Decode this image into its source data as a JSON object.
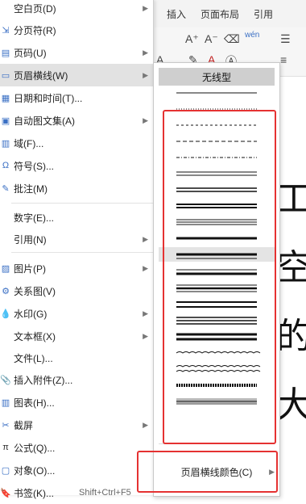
{
  "ribbon": {
    "tabs": [
      {
        "label": "插入"
      },
      {
        "label": "页面布局"
      },
      {
        "label": "引用"
      }
    ]
  },
  "document": {
    "chars": [
      "工",
      "空",
      "的",
      "大"
    ]
  },
  "menu": {
    "items": [
      {
        "label": "空白页(D)",
        "has_submenu": true,
        "icon": "none"
      },
      {
        "label": "分页符(R)",
        "has_submenu": false,
        "icon": "page-break-icon"
      },
      {
        "label": "页码(U)",
        "has_submenu": true,
        "icon": "page-number-icon"
      },
      {
        "label": "页眉横线(W)",
        "has_submenu": true,
        "icon": "header-line-icon",
        "active": true
      },
      {
        "label": "日期和时间(T)...",
        "has_submenu": false,
        "icon": "calendar-icon"
      },
      {
        "label": "自动图文集(A)",
        "has_submenu": true,
        "icon": "autotext-icon"
      },
      {
        "label": "域(F)...",
        "has_submenu": false,
        "icon": "field-icon"
      },
      {
        "label": "符号(S)...",
        "has_submenu": false,
        "icon": "symbol-icon"
      },
      {
        "label": "批注(M)",
        "has_submenu": false,
        "icon": "comment-icon"
      },
      {
        "label": "数字(E)...",
        "has_submenu": false,
        "icon": "none"
      },
      {
        "label": "引用(N)",
        "has_submenu": true,
        "icon": "none"
      },
      {
        "label": "图片(P)",
        "has_submenu": true,
        "icon": "picture-icon"
      },
      {
        "label": "关系图(V)",
        "has_submenu": false,
        "icon": "diagram-icon"
      },
      {
        "label": "水印(G)",
        "has_submenu": true,
        "icon": "watermark-icon"
      },
      {
        "label": "文本框(X)",
        "has_submenu": true,
        "icon": "none"
      },
      {
        "label": "文件(L)...",
        "has_submenu": false,
        "icon": "none"
      },
      {
        "label": "插入附件(Z)...",
        "has_submenu": false,
        "icon": "attachment-icon"
      },
      {
        "label": "图表(H)...",
        "has_submenu": false,
        "icon": "chart-icon"
      },
      {
        "label": "截屏",
        "has_submenu": true,
        "icon": "screenshot-icon"
      },
      {
        "label": "公式(Q)...",
        "has_submenu": false,
        "icon": "formula-icon"
      },
      {
        "label": "对象(O)...",
        "has_submenu": false,
        "icon": "object-icon"
      },
      {
        "label": "书签(K)...",
        "shortcut": "Shift+Ctrl+F5",
        "has_submenu": false,
        "icon": "bookmark-icon"
      }
    ]
  },
  "submenu": {
    "no_line_label": "无线型",
    "line_styles": [
      "single-thin",
      "dotted",
      "dashed",
      "long-dash",
      "dash-dot",
      "double-thin",
      "double-medium",
      "double-thick",
      "triple-thin",
      "single-thick",
      "thick-thin",
      "thin-thick",
      "thin-thick-thin",
      "double-wide",
      "triple-thick",
      "thick-double",
      "wavy",
      "double-wavy",
      "hatched",
      "gradient"
    ],
    "color_label": "页眉横线颜色(C)"
  },
  "colors": {
    "annotation": "#e53232",
    "menu_active": "#e2e2e2",
    "no_line_bg": "#cfcfcf",
    "icon_blue": "#3a6fc4"
  }
}
